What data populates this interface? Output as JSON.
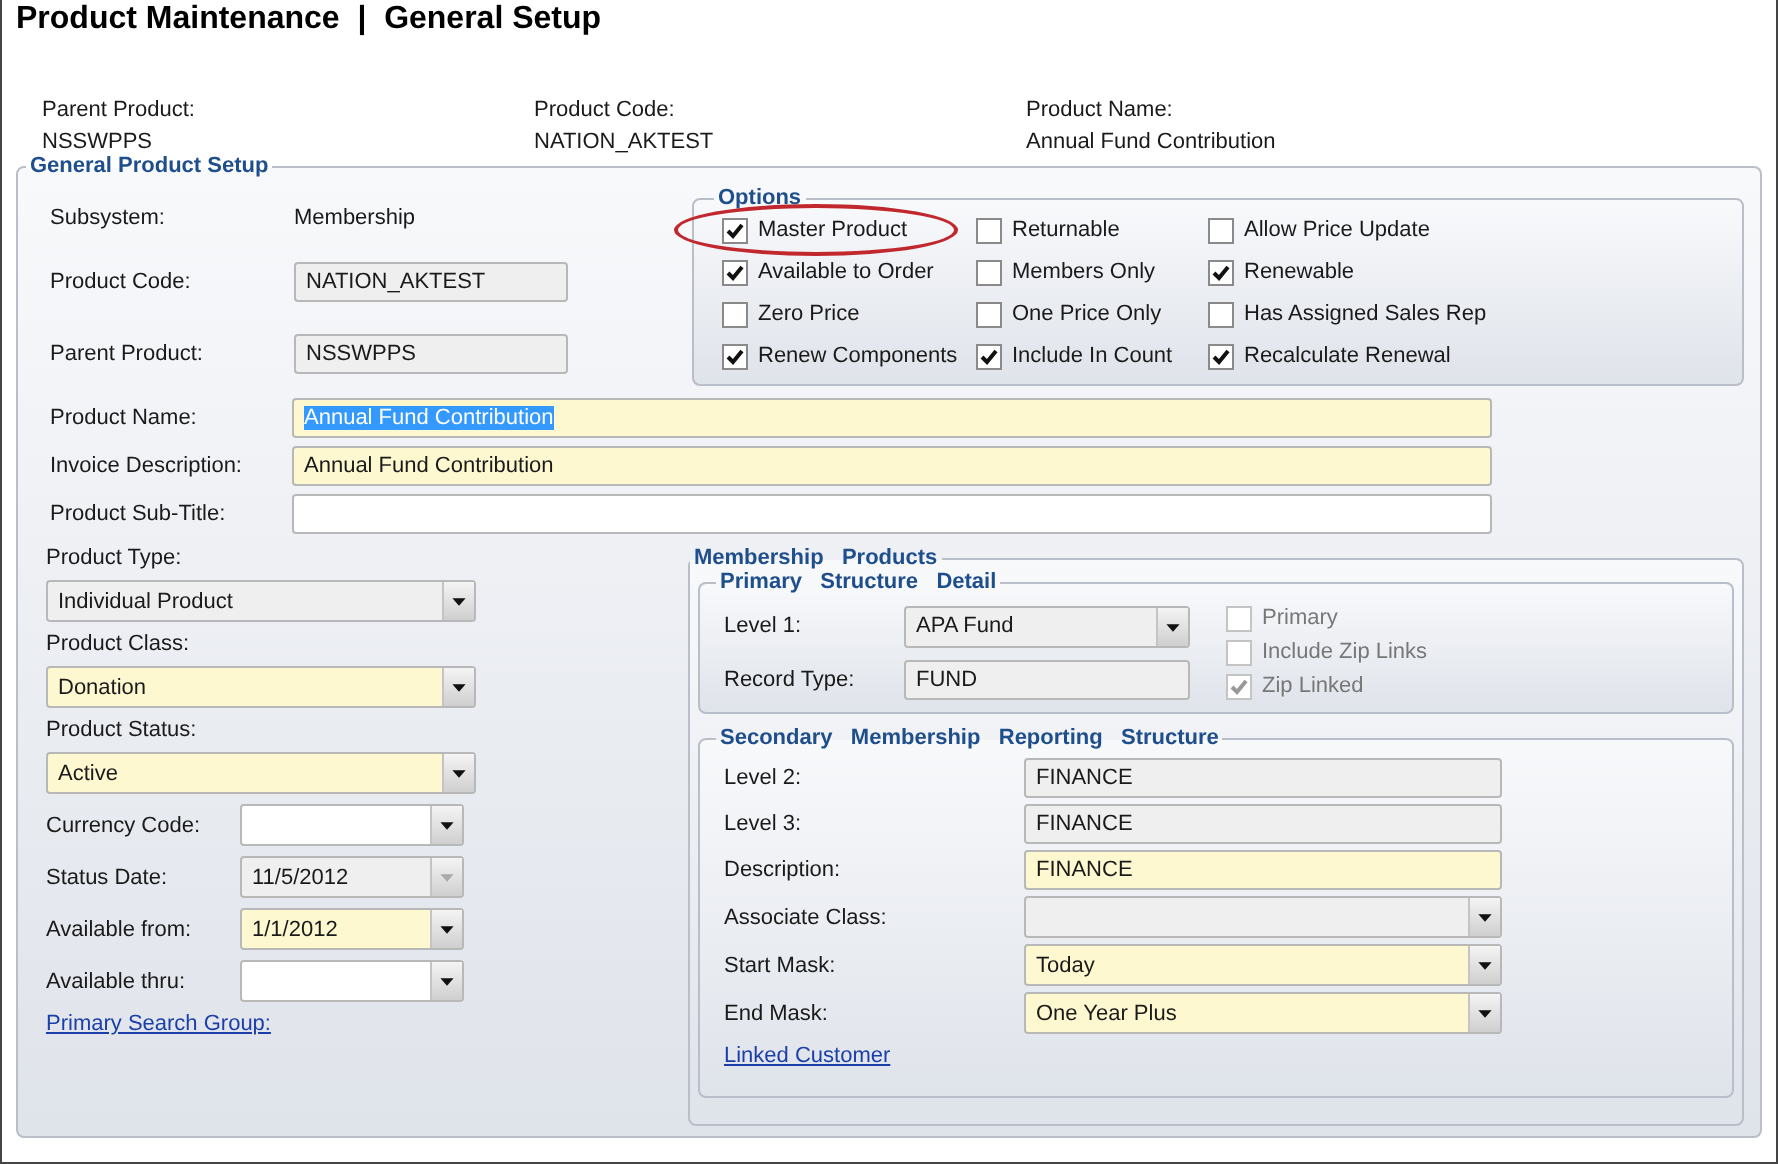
{
  "title": "Product Maintenance  |  General Setup",
  "header": [
    {
      "label": "Parent Product:",
      "value": "NSSWPPS"
    },
    {
      "label": "Product Code:",
      "value": "NATION_AKTEST"
    },
    {
      "label": "Product Name:",
      "value": "Annual Fund Contribution"
    }
  ],
  "general": {
    "legend": "General Product Setup",
    "subsystem": {
      "label": "Subsystem:",
      "value": "Membership"
    },
    "top_fields": [
      {
        "label": "Product Code:",
        "value": "NATION_AKTEST",
        "readonly": true,
        "required": false
      },
      {
        "label": "Parent Product:",
        "value": "NSSWPPS",
        "readonly": true,
        "required": false
      }
    ],
    "options": {
      "legend": "Options",
      "items": [
        {
          "label": "Master Product",
          "checked": true,
          "highlighted": true
        },
        {
          "label": "Returnable",
          "checked": false,
          "highlighted": false
        },
        {
          "label": "Allow Price Update",
          "checked": false,
          "highlighted": false
        },
        {
          "label": "Available to Order",
          "checked": true,
          "highlighted": false
        },
        {
          "label": "Members Only",
          "checked": false,
          "highlighted": false
        },
        {
          "label": "Renewable",
          "checked": true,
          "highlighted": false
        },
        {
          "label": "Zero Price",
          "checked": false,
          "highlighted": false
        },
        {
          "label": "One Price Only",
          "checked": false,
          "highlighted": false
        },
        {
          "label": "Has Assigned Sales Rep",
          "checked": false,
          "highlighted": false
        },
        {
          "label": "Renew Components",
          "checked": true,
          "highlighted": false
        },
        {
          "label": "Include In Count",
          "checked": true,
          "highlighted": false
        },
        {
          "label": "Recalculate Renewal",
          "checked": true,
          "highlighted": false
        }
      ]
    },
    "wide_fields": [
      {
        "label": "Product Name:",
        "value": "Annual Fund Contribution",
        "required": true,
        "readonly": false,
        "text_selected": true
      },
      {
        "label": "Invoice Description:",
        "value": "Annual Fund Contribution",
        "required": true,
        "readonly": false,
        "text_selected": false
      },
      {
        "label": "Product Sub-Title:",
        "required": false,
        "readonly": false
      }
    ],
    "left_items": [
      {
        "kind": "stacked",
        "label": "Product Type:",
        "value": "Individual Product",
        "readonly": true,
        "required": false,
        "disabled": false
      },
      {
        "kind": "stacked",
        "label": "Product Class:",
        "value": "Donation",
        "readonly": false,
        "required": true,
        "disabled": false
      },
      {
        "kind": "stacked",
        "label": "Product Status:",
        "value": "Active",
        "readonly": false,
        "required": true,
        "disabled": false
      },
      {
        "kind": "inline",
        "label": "Currency Code:",
        "readonly": false,
        "required": false,
        "disabled": false
      },
      {
        "kind": "inline",
        "label": "Status Date:",
        "value": "11/5/2012",
        "readonly": true,
        "required": false,
        "disabled": true
      },
      {
        "kind": "inline",
        "label": "Available from:",
        "value": "1/1/2012",
        "readonly": false,
        "required": true,
        "disabled": false
      },
      {
        "kind": "inline",
        "label": "Available thru:",
        "readonly": false,
        "required": false,
        "disabled": false
      },
      {
        "kind": "link",
        "label": "Primary Search Group:"
      }
    ],
    "membership": {
      "legend": "Membership   Products",
      "primary": {
        "legend": "Primary   Structure   Detail",
        "rows": [
          {
            "label": "Level 1:",
            "value": "APA Fund",
            "kind": "select",
            "readonly": true,
            "required": false
          },
          {
            "label": "Record Type:",
            "value": "FUND",
            "kind": "field",
            "readonly": true,
            "required": false
          }
        ],
        "checks": [
          {
            "label": "Primary",
            "checked": false,
            "disabled": true
          },
          {
            "label": "Include Zip Links",
            "checked": false,
            "disabled": true
          },
          {
            "label": "Zip Linked",
            "checked": true,
            "disabled": true
          }
        ]
      },
      "secondary": {
        "legend": "Secondary   Membership   Reporting   Structure",
        "rows": [
          {
            "label": "Level 2:",
            "value": "FINANCE",
            "kind": "field",
            "readonly": true,
            "required": false
          },
          {
            "label": "Level 3:",
            "value": "FINANCE",
            "kind": "field",
            "readonly": true,
            "required": false
          },
          {
            "label": "Description:",
            "value": "FINANCE",
            "kind": "field",
            "readonly": false,
            "required": true
          },
          {
            "label": "Associate Class:",
            "kind": "select",
            "readonly": true,
            "required": false
          },
          {
            "label": "Start Mask:",
            "value": "Today",
            "kind": "select",
            "readonly": false,
            "required": true
          },
          {
            "label": "End Mask:",
            "value": "One Year Plus",
            "kind": "select",
            "readonly": false,
            "required": true
          }
        ],
        "link": "Linked Customer"
      }
    }
  }
}
